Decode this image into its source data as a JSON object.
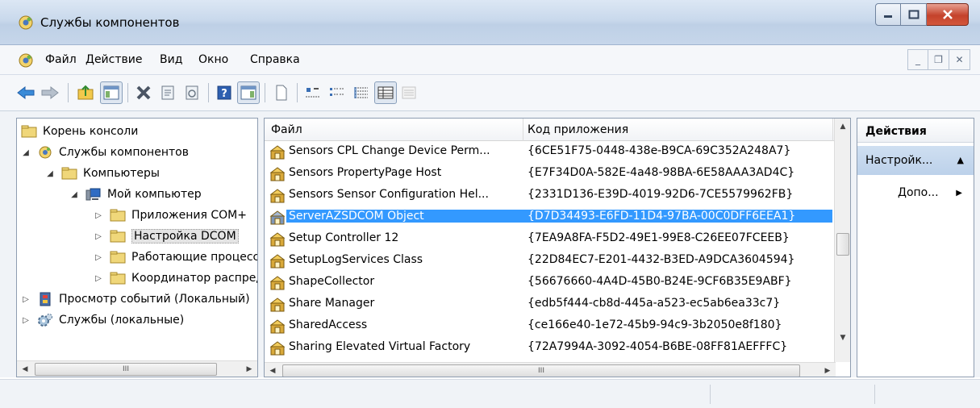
{
  "window": {
    "title": "Службы компонентов"
  },
  "menu": {
    "items": [
      {
        "label": "Файл"
      },
      {
        "label": "Действие"
      },
      {
        "label": "Вид"
      },
      {
        "label": "Окно"
      },
      {
        "label": "Справка"
      }
    ]
  },
  "toolbar": {
    "buttons": [
      "back-icon",
      "forward-icon",
      "up-folder-icon",
      "show-hide-tree-icon",
      "delete-icon",
      "properties-icon",
      "refresh-icon",
      "help-icon",
      "show-action-pane-icon",
      "new-window-icon",
      "large-icons-view-icon",
      "small-icons-view-icon",
      "list-view-icon",
      "details-view-icon",
      "extra-view-icon"
    ]
  },
  "tree": {
    "items": [
      {
        "label": "Корень консоли",
        "icon": "folder-icon",
        "expander": ""
      },
      {
        "label": "Службы компонентов",
        "icon": "component-services-icon",
        "expander": "◢"
      },
      {
        "label": "Компьютеры",
        "icon": "folder-icon",
        "expander": "◢"
      },
      {
        "label": "Мой компьютер",
        "icon": "computer-icon",
        "expander": "◢"
      },
      {
        "label": "Приложения COM+",
        "icon": "folder-icon",
        "expander": "▷"
      },
      {
        "label": "Настройка DCOM",
        "icon": "folder-icon",
        "expander": "▷"
      },
      {
        "label": "Работающие процессы",
        "icon": "folder-icon",
        "expander": "▷"
      },
      {
        "label": "Координатор распределенных транзакций",
        "icon": "folder-icon",
        "expander": "▷"
      },
      {
        "label": "Просмотр событий (Локальный)",
        "icon": "event-viewer-icon",
        "expander": "▷"
      },
      {
        "label": "Службы (локальные)",
        "icon": "services-gear-icon",
        "expander": "▷"
      }
    ],
    "scroll_thumb_glyph": "III"
  },
  "list": {
    "columns": {
      "name": "Файл",
      "appid": "Код приложения"
    },
    "rows": [
      {
        "name": "Sensors CPL Change Device Perm...",
        "appid": "{6CE51F75-0448-438e-B9CA-69C352A248A7}"
      },
      {
        "name": "Sensors PropertyPage Host",
        "appid": "{E7F34D0A-582E-4a48-98BA-6E58AAA3AD4C}"
      },
      {
        "name": "Sensors Sensor Configuration Hel...",
        "appid": "{2331D136-E39D-4019-92D6-7CE5579962FB}"
      },
      {
        "name": "ServerAZSDCOM Object",
        "appid": "{D7D34493-E6FD-11D4-97BA-00C0DFF6EEA1}"
      },
      {
        "name": "Setup Controller 12",
        "appid": "{7EA9A8FA-F5D2-49E1-99E8-C26EE07FCEEB}"
      },
      {
        "name": "SetupLogServices Class",
        "appid": "{22D84EC7-E201-4432-B3ED-A9DCA3604594}"
      },
      {
        "name": "ShapeCollector",
        "appid": "{56676660-4A4D-45B0-B24E-9CF6B35E9ABF}"
      },
      {
        "name": "Share Manager",
        "appid": "{edb5f444-cb8d-445a-a523-ec5ab6ea33c7}"
      },
      {
        "name": "SharedAccess",
        "appid": "{ce166e40-1e72-45b9-94c9-3b2050e8f180}"
      },
      {
        "name": "Sharing Elevated Virtual Factory",
        "appid": "{72A7994A-3092-4054-B6BE-08FF81AEFFFC}"
      }
    ],
    "selected_index": 3,
    "scroll_thumb_glyph": "III"
  },
  "actions": {
    "header": "Действия",
    "group": "Настройк...",
    "items": [
      {
        "label": "Допо..."
      }
    ]
  },
  "colors": {
    "selection": "#3399ff",
    "title_bar": "#c9d9ec",
    "action_group": "#c6d8ee"
  }
}
